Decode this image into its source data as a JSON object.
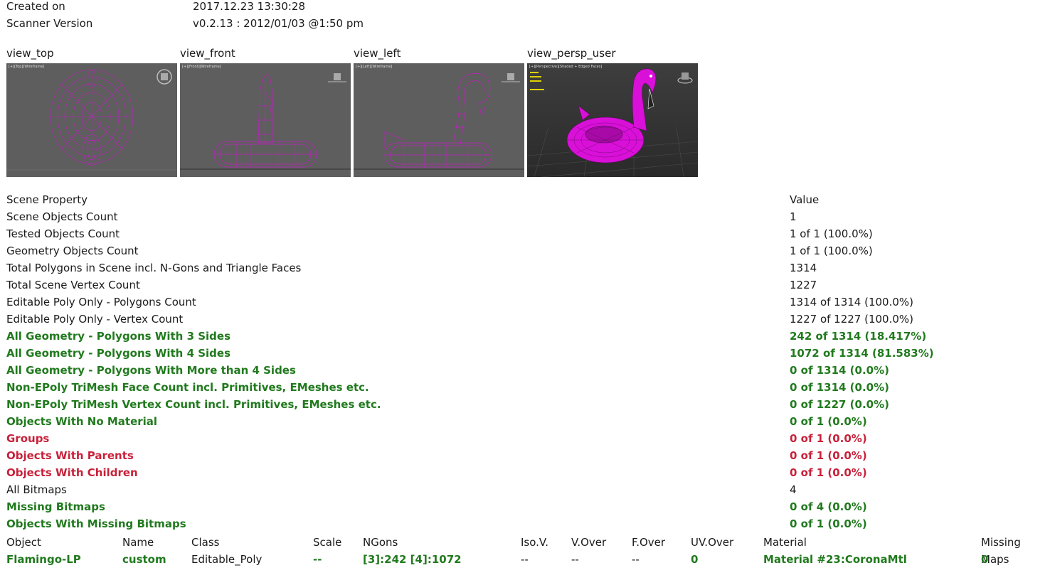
{
  "header": {
    "created_label": "Created on",
    "created_value": "2017.12.23 13:30:28",
    "scanner_label": "Scanner Version",
    "scanner_value": "v0.2.13 : 2012/01/03 @1:50 pm"
  },
  "views": [
    {
      "label": "view_top",
      "viewport_tag": "[+][Top][Wireframe]",
      "icon": "viewcube-icon"
    },
    {
      "label": "view_front",
      "viewport_tag": "[+][Front][Wireframe]",
      "icon": "viewcube-icon"
    },
    {
      "label": "view_left",
      "viewport_tag": "[+][Left][Wireframe]",
      "icon": "viewcube-icon"
    },
    {
      "label": "view_persp_user",
      "viewport_tag": "[+][Perspective][Shaded + Edged Faces]",
      "icon": "viewcube-icon"
    }
  ],
  "colors": {
    "green": "#217a1e",
    "red": "#c8213a",
    "wire": "#c21fc2",
    "viewport_bg": "#5f5f5f"
  },
  "table": {
    "header": {
      "prop": "Scene Property",
      "value": "Value"
    },
    "rows": [
      {
        "prop": "Scene Objects Count",
        "value": "1",
        "status": "normal"
      },
      {
        "prop": "Tested Objects Count",
        "value": "1 of 1 (100.0%)",
        "status": "normal"
      },
      {
        "prop": "Geometry Objects Count",
        "value": "1 of 1 (100.0%)",
        "status": "normal"
      },
      {
        "prop": "Total Polygons in Scene incl. N-Gons and Triangle Faces",
        "value": "1314",
        "status": "normal"
      },
      {
        "prop": "Total Scene Vertex Count",
        "value": "1227",
        "status": "normal"
      },
      {
        "prop": "Editable Poly Only - Polygons Count",
        "value": "1314 of 1314 (100.0%)",
        "status": "normal"
      },
      {
        "prop": "Editable Poly Only - Vertex Count",
        "value": "1227 of 1227 (100.0%)",
        "status": "normal"
      },
      {
        "prop": "All Geometry - Polygons With 3 Sides",
        "value": "242 of 1314 (18.417%)",
        "status": "green"
      },
      {
        "prop": "All Geometry - Polygons With 4 Sides",
        "value": "1072 of 1314 (81.583%)",
        "status": "green"
      },
      {
        "prop": "All Geometry - Polygons With More than 4 Sides",
        "value": "0 of 1314 (0.0%)",
        "status": "green"
      },
      {
        "prop": "Non-EPoly TriMesh Face Count incl. Primitives, EMeshes etc.",
        "value": "0 of 1314 (0.0%)",
        "status": "green"
      },
      {
        "prop": "Non-EPoly TriMesh Vertex Count incl. Primitives, EMeshes etc.",
        "value": "0 of 1227 (0.0%)",
        "status": "green"
      },
      {
        "prop": "Objects With No Material",
        "value": "0 of 1 (0.0%)",
        "status": "green"
      },
      {
        "prop": "Groups",
        "value": "0 of 1 (0.0%)",
        "status": "red"
      },
      {
        "prop": "Objects With Parents",
        "value": "0 of 1 (0.0%)",
        "status": "red"
      },
      {
        "prop": "Objects With Children",
        "value": "0 of 1 (0.0%)",
        "status": "red"
      },
      {
        "prop": "All Bitmaps",
        "value": "4",
        "status": "normal"
      },
      {
        "prop": "Missing Bitmaps",
        "value": "0 of 4 (0.0%)",
        "status": "green"
      },
      {
        "prop": "Objects With Missing Bitmaps",
        "value": "0 of 1 (0.0%)",
        "status": "green"
      }
    ]
  },
  "objects": {
    "columns": [
      "Object",
      "Name",
      "Class",
      "Scale",
      "NGons",
      "Iso.V.",
      "V.Over",
      "F.Over",
      "UV.Over",
      "Material",
      "Missing Maps"
    ],
    "rows": [
      {
        "object": "Flamingo-LP",
        "name": "custom",
        "class": "Editable_Poly",
        "scale": "--",
        "ngons": "[3]:242 [4]:1072",
        "iso_v": "--",
        "v_over": "--",
        "f_over": "--",
        "uv_over": "0",
        "material": "Material #23:CoronaMtl",
        "missing_maps": "0"
      }
    ]
  }
}
